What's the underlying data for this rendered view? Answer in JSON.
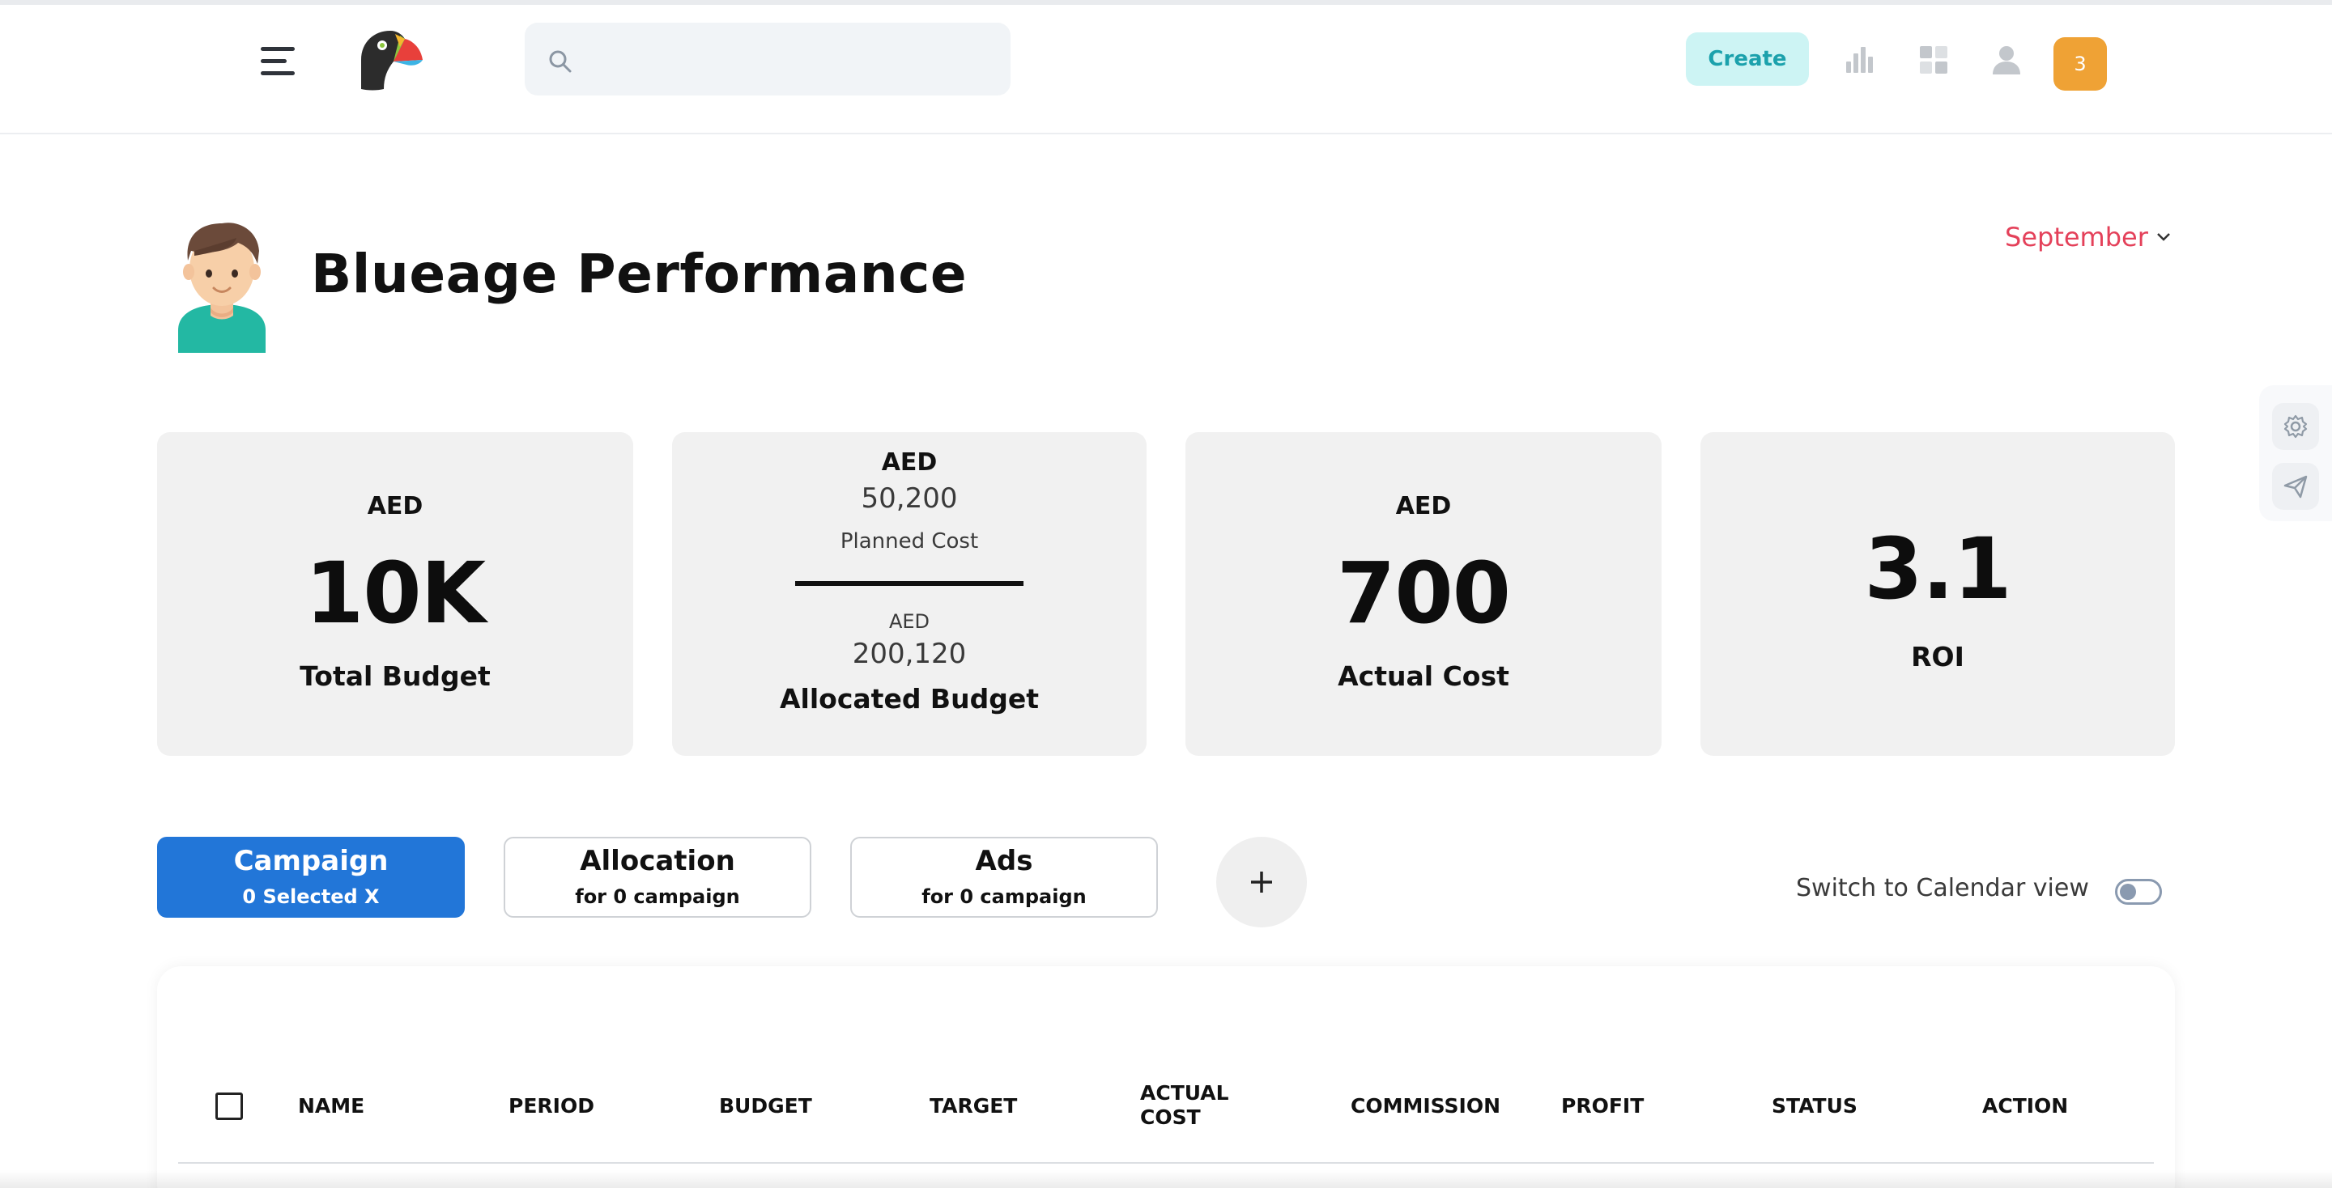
{
  "topbar": {
    "search_placeholder": "",
    "create_label": "Create",
    "notifications_count": "3",
    "icons": [
      "menu-icon",
      "toucan-logo",
      "search-icon",
      "bar-chart-icon",
      "apps-grid-icon",
      "user-icon"
    ]
  },
  "header": {
    "title": "Blueage Performance",
    "month": "September"
  },
  "stats": {
    "total_budget": {
      "currency": "AED",
      "value": "10K",
      "label": "Total Budget"
    },
    "allocated": {
      "planned_currency": "AED",
      "planned_value": "50,200",
      "planned_label": "Planned Cost",
      "allocated_currency": "AED",
      "allocated_value": "200,120",
      "allocated_label": "Allocated Budget"
    },
    "actual_cost": {
      "currency": "AED",
      "value": "700",
      "label": "Actual Cost"
    },
    "roi": {
      "value": "3.1",
      "label": "ROI"
    }
  },
  "tabs": [
    {
      "title": "Campaign",
      "sub": "0 Selected X"
    },
    {
      "title": "Allocation",
      "sub": "for 0 campaign"
    },
    {
      "title": "Ads",
      "sub": "for 0 campaign"
    }
  ],
  "calendar_toggle": {
    "label": "Switch to Calendar view",
    "on": false
  },
  "table": {
    "columns": [
      "NAME",
      "PERIOD",
      "BUDGET",
      "TARGET",
      "ACTUAL COST",
      "COMMISSION",
      "PROFIT",
      "STATUS",
      "ACTION"
    ]
  },
  "colors": {
    "primary": "#2276d8",
    "create_bg": "#cdf4f4",
    "create_text": "#1ba1ac",
    "badge": "#efa235",
    "month": "#e4415a",
    "card_bg": "#f1f1f1"
  }
}
